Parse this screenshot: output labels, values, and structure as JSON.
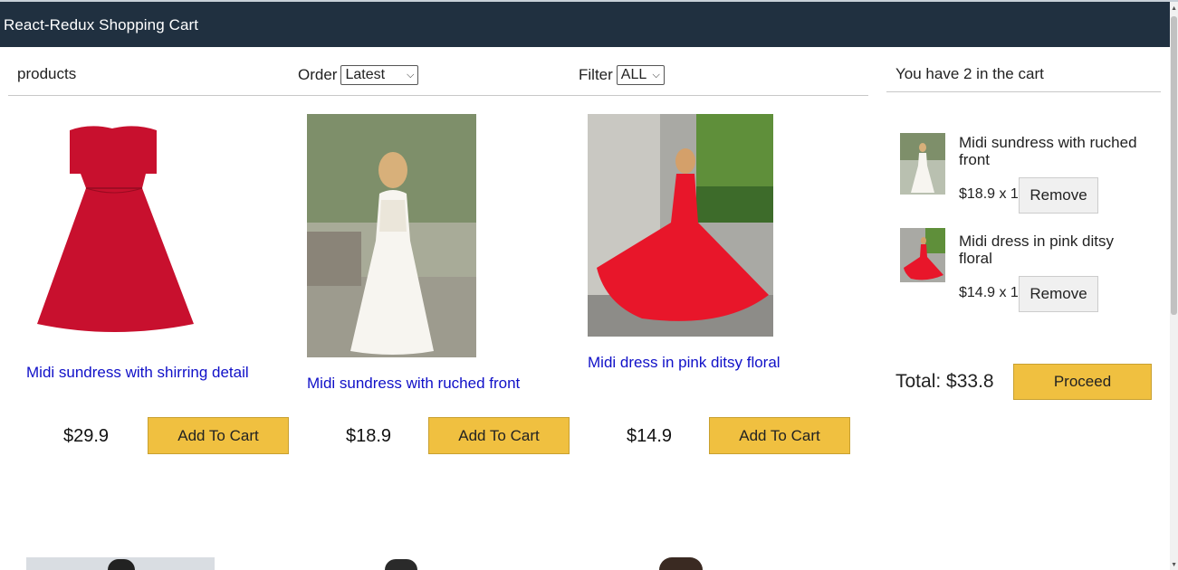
{
  "header": {
    "title": "React-Redux Shopping Cart"
  },
  "filter_bar": {
    "products_label": "products",
    "order_label": "Order",
    "order_value": "Latest",
    "filter_label": "Filter",
    "filter_value": "ALL"
  },
  "products": [
    {
      "title": "Midi sundress with shirring detail",
      "price": "$29.9",
      "button": "Add To Cart",
      "image": "red-strapless-dress"
    },
    {
      "title": "Midi sundress with ruched front",
      "price": "$18.9",
      "button": "Add To Cart",
      "image": "white-bridal-gown"
    },
    {
      "title": "Midi dress in pink ditsy floral",
      "price": "$14.9",
      "button": "Add To Cart",
      "image": "red-flowing-dress"
    }
  ],
  "cart": {
    "count_text": "You have 2 in the cart",
    "items": [
      {
        "title": "Midi sundress with ruched front",
        "price_qty": "$18.9 x 1",
        "remove": "Remove"
      },
      {
        "title": "Midi dress in pink ditsy floral",
        "price_qty": "$14.9 x 1",
        "remove": "Remove"
      }
    ],
    "total": "Total: $33.8",
    "proceed": "Proceed"
  },
  "colors": {
    "header_bg": "#203040",
    "button_yellow": "#f0c040",
    "link_blue": "#1010c8"
  }
}
